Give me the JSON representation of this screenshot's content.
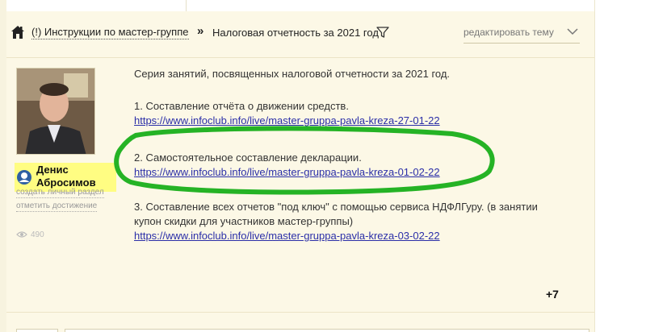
{
  "breadcrumb": {
    "parent_label": "(!) Инструкции по мастер-группе",
    "separator": "»",
    "current_label": "Налоговая отчетность за 2021 год"
  },
  "edit_topic": {
    "label": "редактировать тему"
  },
  "author": {
    "name_line1": "Денис",
    "name_line2": "Абросимов",
    "create_section_link": "создать личный раздел",
    "mark_achievement_link": "отметить достижение",
    "views_count": "490"
  },
  "post": {
    "intro": "Серия занятий, посвященных налоговой отчетности за 2021 год.",
    "items": [
      {
        "text": "1. Составление отчёта о движении средств.",
        "link": "https://www.infoclub.info/live/master-gruppa-pavla-kreza-27-01-22"
      },
      {
        "text": "2. Самостоятельное составление декларации.",
        "link": "https://www.infoclub.info/live/master-gruppa-pavla-kreza-01-02-22"
      },
      {
        "text": "3. Составление всех отчетов \"под ключ\" с помощью сервиса НДФЛГуру. (в занятии",
        "text_cont": "купон скидки для участников мастер-группы)",
        "link": "https://www.infoclub.info/live/master-gruppa-pavla-kreza-03-02-22"
      }
    ]
  },
  "reactions": {
    "plus_count": "+7"
  },
  "colors": {
    "panel_bg": "#fcf8e6",
    "name_highlight": "#fffd82",
    "link": "#2b2fa8",
    "annotation_green": "#25b325"
  },
  "icons": {
    "home": "home-icon",
    "filter": "filter-icon",
    "chevron": "chevron-down-icon",
    "user": "user-icon",
    "eye": "eye-icon",
    "close": "close-icon"
  }
}
